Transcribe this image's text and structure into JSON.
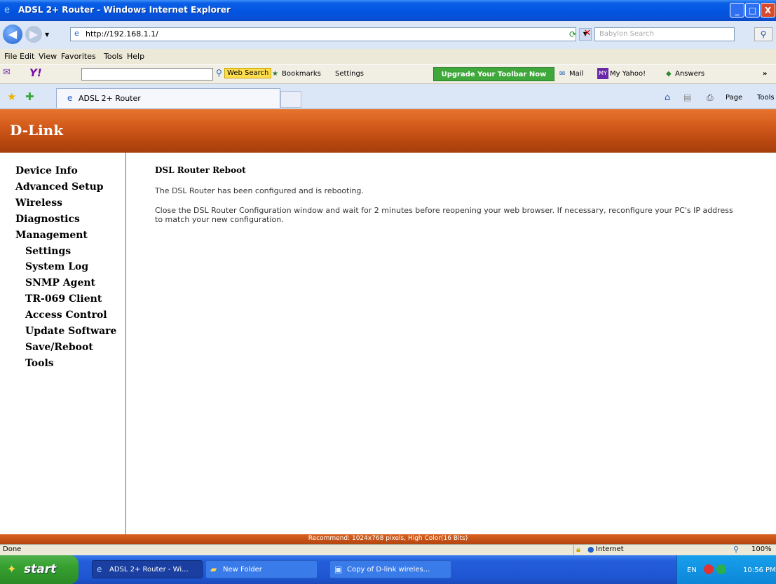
{
  "window": {
    "title": "ADSL 2+ Router - Windows Internet Explorer",
    "minimize": "_",
    "maximize": "□",
    "close": "X"
  },
  "address_bar": {
    "url": "http://192.168.1.1/",
    "search_placeholder": "Babylon Search"
  },
  "menu": [
    "File",
    "Edit",
    "View",
    "Favorites",
    "Tools",
    "Help"
  ],
  "yahoo_toolbar": {
    "web_search": "Web Search",
    "bookmarks": "Bookmarks",
    "settings": "Settings",
    "upgrade": "Upgrade Your Toolbar Now",
    "mail": "Mail",
    "my_yahoo": "My Yahoo!",
    "answers": "Answers",
    "more": "»"
  },
  "tab": {
    "label": "ADSL 2+ Router",
    "page": "Page",
    "tools": "Tools"
  },
  "page": {
    "logo": "D-Link",
    "nav": [
      {
        "label": "Device Info",
        "level": "top"
      },
      {
        "label": "Advanced Setup",
        "level": "top"
      },
      {
        "label": "Wireless",
        "level": "top"
      },
      {
        "label": "Diagnostics",
        "level": "top"
      },
      {
        "label": "Management",
        "level": "top"
      },
      {
        "label": "Settings",
        "level": "sub"
      },
      {
        "label": "System Log",
        "level": "sub"
      },
      {
        "label": "SNMP Agent",
        "level": "sub"
      },
      {
        "label": "TR-069 Client",
        "level": "sub"
      },
      {
        "label": "Access Control",
        "level": "sub"
      },
      {
        "label": "Update Software",
        "level": "sub"
      },
      {
        "label": "Save/Reboot",
        "level": "sub"
      },
      {
        "label": "Tools",
        "level": "sub"
      }
    ],
    "title": "DSL Router Reboot",
    "p1": "The DSL Router has been configured and is rebooting.",
    "p2": "Close the DSL Router Configuration window and wait for 2 minutes before reopening your web browser. If necessary, reconfigure your PC's IP address to match your new configuration.",
    "footer": "Recommend: 1024x768 pixels, High Color(16 Bits)"
  },
  "status": {
    "left": "Done",
    "zone": "Internet",
    "zoom": "100%"
  },
  "taskbar": {
    "start": "start",
    "items": [
      "ADSL 2+ Router - Wi...",
      "New Folder",
      "Copy of D-link wireles..."
    ],
    "lang": "EN",
    "time": "10:56 PM"
  },
  "colors": {
    "header_orange": "#d25a1b",
    "xp_blue": "#0254e0",
    "start_green": "#36a02f"
  }
}
